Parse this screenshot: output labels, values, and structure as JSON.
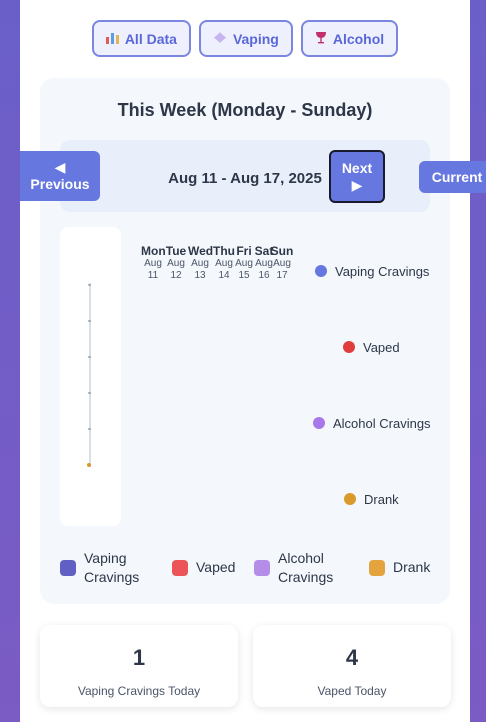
{
  "filters": [
    {
      "label": "All Data",
      "icon": "bar-chart-icon"
    },
    {
      "label": "Vaping",
      "icon": "vape-icon"
    },
    {
      "label": "Alcohol",
      "icon": "wine-glass-icon"
    }
  ],
  "week": {
    "title": "This Week (Monday - Sunday)",
    "range": "Aug 11 - Aug 17, 2025",
    "prev_label": "◀ Previous",
    "next_label": "Next ▶",
    "current_label": "Current"
  },
  "days": [
    {
      "name": "Mon",
      "month": "Aug",
      "date": "11"
    },
    {
      "name": "Tue",
      "month": "Aug",
      "date": "12"
    },
    {
      "name": "Wed",
      "month": "Aug",
      "date": "13"
    },
    {
      "name": "Thu",
      "month": "Aug",
      "date": "14"
    },
    {
      "name": "Fri",
      "month": "Aug",
      "date": "15"
    },
    {
      "name": "Sat",
      "month": "Aug",
      "date": "16"
    },
    {
      "name": "Sun",
      "month": "Aug",
      "date": "17"
    }
  ],
  "side_legend": [
    {
      "label": "Vaping Cravings",
      "color": "#6677e0"
    },
    {
      "label": "Vaped",
      "color": "#e03d3d"
    },
    {
      "label": "Alcohol Cravings",
      "color": "#a978e8"
    },
    {
      "label": "Drank",
      "color": "#d99a2b"
    }
  ],
  "legend": [
    {
      "label": "Vaping Cravings",
      "color": "#5f5fc4"
    },
    {
      "label": "Vaped",
      "color": "#ec5457"
    },
    {
      "label": "Alcohol Cravings",
      "color": "#b48de8"
    },
    {
      "label": "Drank",
      "color": "#e3a43f"
    }
  ],
  "stats": [
    {
      "value": "1",
      "label": "Vaping Cravings Today"
    },
    {
      "value": "4",
      "label": "Vaped Today"
    }
  ]
}
